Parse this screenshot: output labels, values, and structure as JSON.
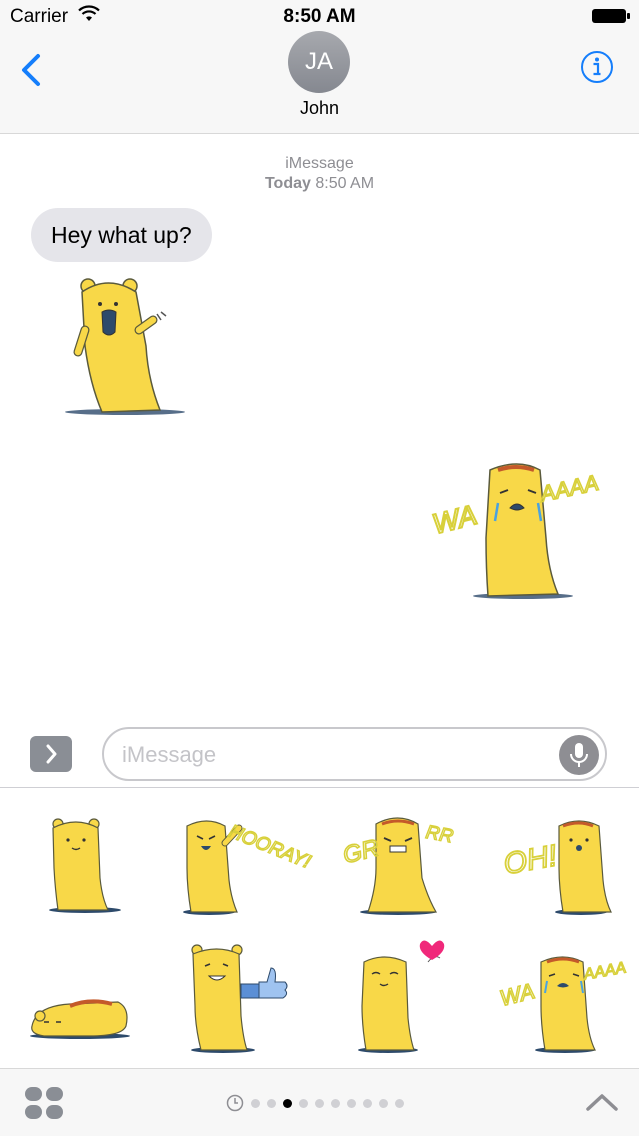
{
  "status": {
    "carrier": "Carrier",
    "time": "8:50 AM"
  },
  "nav": {
    "avatar_initials": "JA",
    "contact_name": "John"
  },
  "conversation": {
    "service": "iMessage",
    "date_label": "Today",
    "time": "8:50 AM",
    "messages": [
      {
        "from": "them",
        "text": "Hey what up?"
      }
    ]
  },
  "stickers_sent": [
    {
      "name": "waving",
      "caption": ""
    },
    {
      "name": "crying",
      "caption": "WAAAAAA"
    }
  ],
  "compose": {
    "placeholder": "iMessage"
  },
  "drawer": {
    "stickers": [
      {
        "name": "standing",
        "caption": ""
      },
      {
        "name": "hooray",
        "caption": "HOORAY!"
      },
      {
        "name": "grr",
        "caption": "GRRR"
      },
      {
        "name": "oh",
        "caption": "OH!"
      },
      {
        "name": "lying",
        "caption": ""
      },
      {
        "name": "thumbs-up",
        "caption": ""
      },
      {
        "name": "love",
        "caption": ""
      },
      {
        "name": "crying",
        "caption": "WAAAAAA"
      }
    ],
    "page_count": 10,
    "active_page": 2
  },
  "colors": {
    "accent": "#157efb",
    "bear": "#f8d848",
    "bear_outline": "#5a5a3c",
    "heart": "#f0287a",
    "caption": "#ece45a",
    "thumb": "#5b8fd6"
  }
}
